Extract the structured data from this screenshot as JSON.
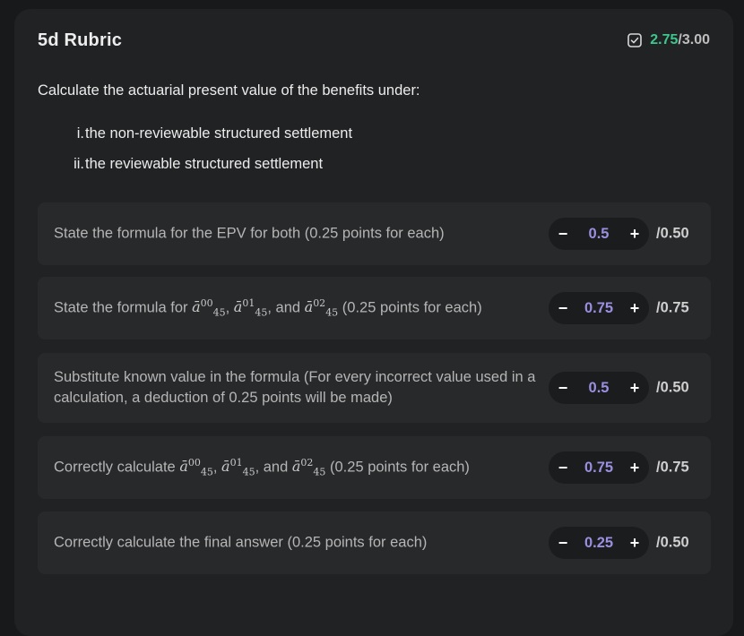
{
  "rubric": {
    "title": "5d Rubric",
    "score": "2.75",
    "score_separator": "/",
    "max": "3.00",
    "prompt": "Calculate the actuarial present value of the benefits under:",
    "sub_items": [
      {
        "num": "i.",
        "text": "the non-reviewable structured settlement"
      },
      {
        "num": "ii.",
        "text": "the reviewable structured settlement"
      }
    ],
    "criteria": [
      {
        "text": "State the formula for the EPV for both (0.25 points for each)",
        "value": "0.5",
        "max": "/0.50"
      },
      {
        "pre": "State the formula for ",
        "mid1": ", ",
        "mid2": ", and ",
        "post": " (0.25 points for each)",
        "value": "0.75",
        "max": "/0.75"
      },
      {
        "text": "Substitute known value in the formula (For every incorrect value used in a calculation, a deduction of 0.25 points will be made)",
        "value": "0.5",
        "max": "/0.50"
      },
      {
        "pre": "Correctly calculate ",
        "mid1": ", ",
        "mid2": ", and ",
        "post": " (0.25 points for each)",
        "value": "0.75",
        "max": "/0.75"
      },
      {
        "text": "Correctly calculate the final answer (0.25 points for each)",
        "value": "0.25",
        "max": "/0.50"
      }
    ],
    "math": {
      "symbol": "ā",
      "sub": "45",
      "sup00": "00",
      "sup01": "01",
      "sup02": "02"
    },
    "controls": {
      "minus": "−",
      "plus": "+"
    },
    "colors": {
      "score": "#3cc88c",
      "value": "#9a8fe0",
      "card": "#212224",
      "row": "#28292b"
    }
  }
}
